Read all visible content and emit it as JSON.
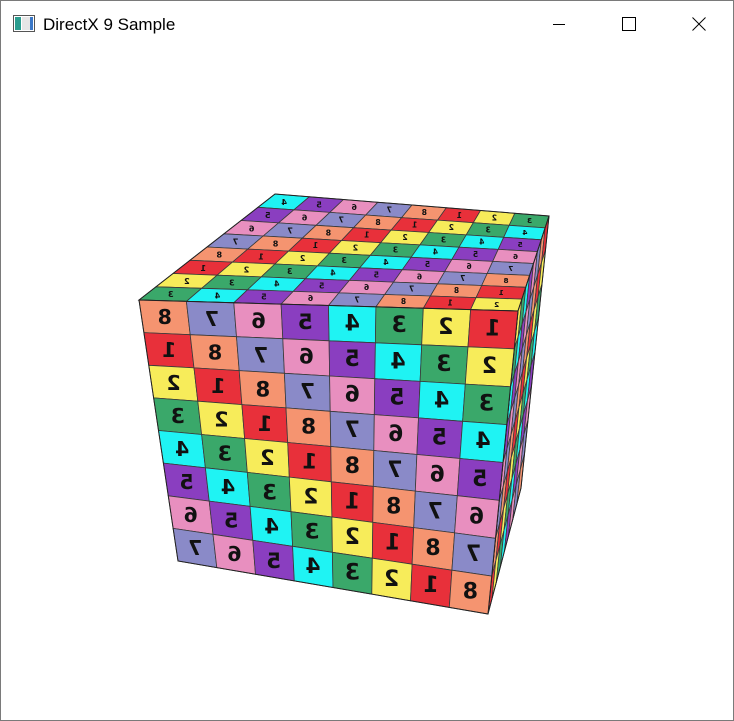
{
  "window": {
    "title": "DirectX 9 Sample",
    "icon": "app-window-icon",
    "buttons": {
      "minimize": "minimize-icon",
      "maximize": "maximize-icon",
      "close": "close-icon"
    }
  },
  "scene": {
    "object": "textured-cube",
    "tile_labels": [
      "1",
      "2",
      "3",
      "4",
      "5",
      "6",
      "7",
      "8"
    ],
    "colors": {
      "1": "#e8303a",
      "2": "#f7ec5a",
      "3": "#3aa86a",
      "4": "#1ff3f3",
      "5": "#8a3ec0",
      "6": "#e88fbf",
      "7": "#8a8ac8",
      "8": "#f59470"
    }
  }
}
